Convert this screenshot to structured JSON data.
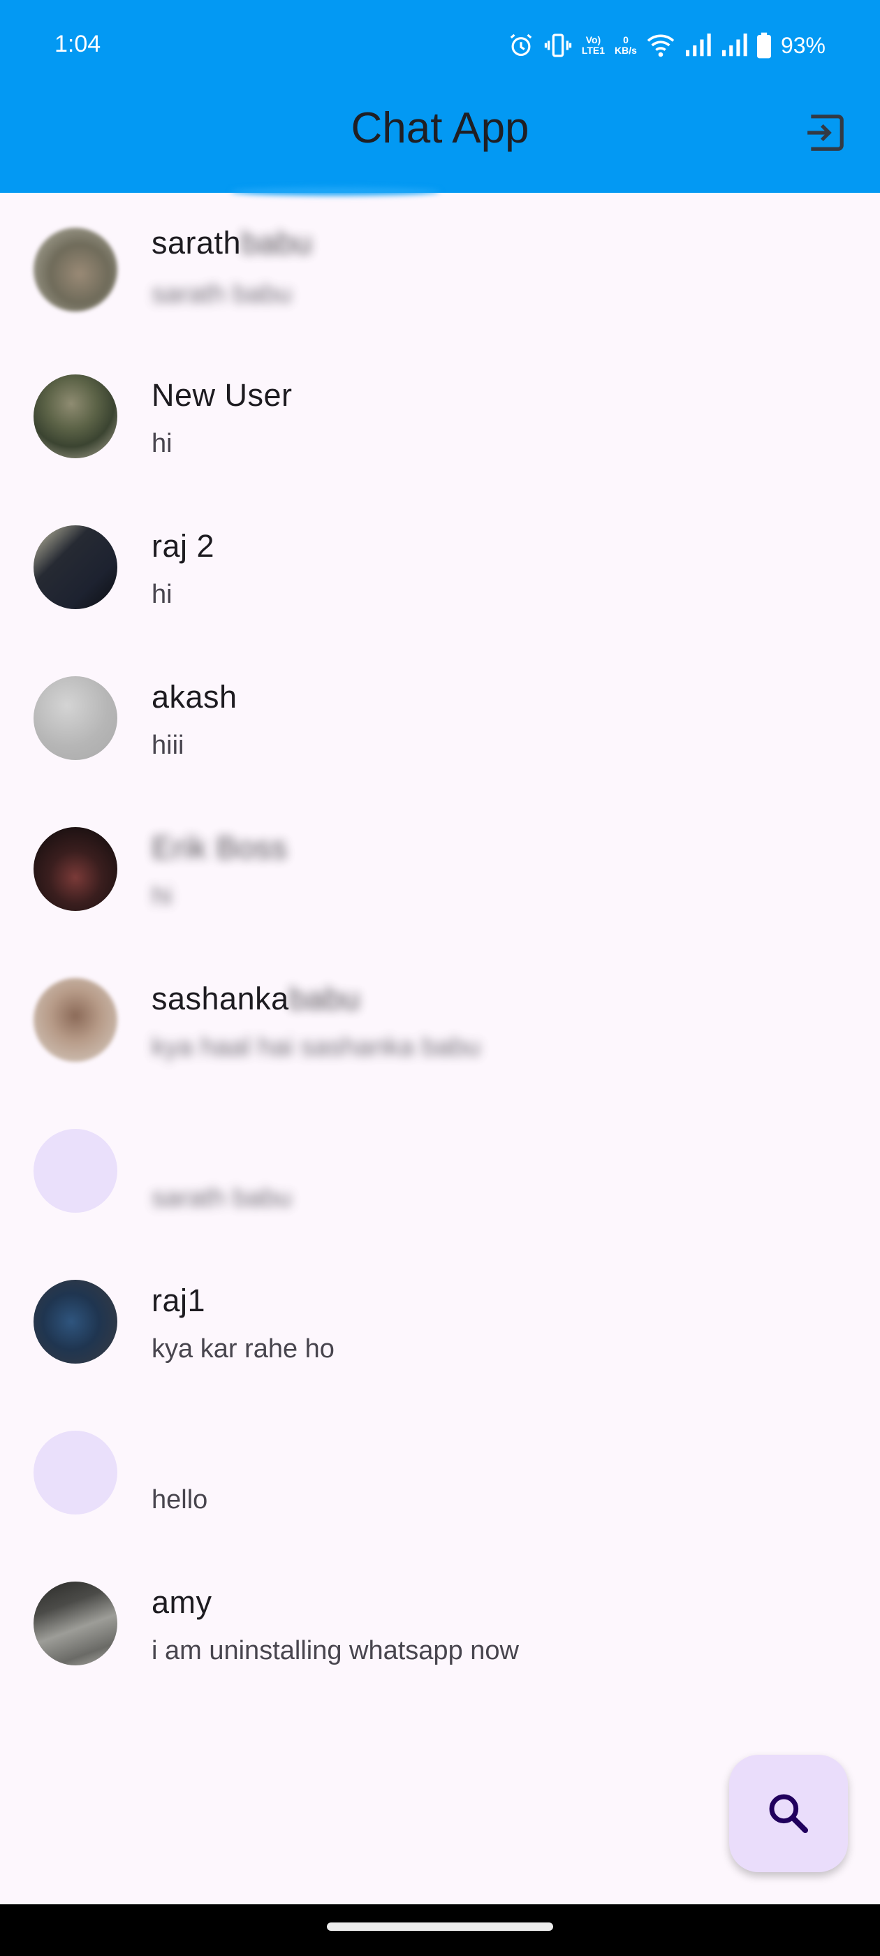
{
  "status_bar": {
    "time": "1:04",
    "net_top": "Vo)",
    "net_bottom": "LTE1",
    "speed_top": "0",
    "speed_bottom": "KB/s",
    "battery": "93%"
  },
  "app_bar": {
    "title": "Chat App",
    "action_icon": "logout-icon"
  },
  "chats": [
    {
      "name": "sarath",
      "name_hidden": "babu",
      "message": "sarath babu",
      "avatar": "photo",
      "blur_message": true
    },
    {
      "name": "New User",
      "name_hidden": "",
      "message": "hi",
      "avatar": "photo",
      "blur_message": false
    },
    {
      "name": "raj 2",
      "name_hidden": "",
      "message": "hi",
      "avatar": "photo",
      "blur_message": false
    },
    {
      "name": "akash",
      "name_hidden": "",
      "message": "hiii",
      "avatar": "photo",
      "blur_message": false
    },
    {
      "name": "",
      "name_hidden": "Erik Boss",
      "message": "hi",
      "avatar": "photo",
      "blur_message": true
    },
    {
      "name": "sashanka",
      "name_hidden": "babu",
      "message": "kya haal hai sashanka babu",
      "avatar": "photo",
      "blur_message": true
    },
    {
      "name": "",
      "name_hidden": "",
      "message": "sarath babu",
      "avatar": "blank",
      "blur_message": true
    },
    {
      "name": "raj1",
      "name_hidden": "",
      "message": "kya kar rahe ho",
      "avatar": "photo",
      "blur_message": false
    },
    {
      "name": "",
      "name_hidden": "",
      "message": "hello",
      "avatar": "blank",
      "blur_message": false
    },
    {
      "name": "amy",
      "name_hidden": "",
      "message": "i am uninstalling whatsapp now",
      "avatar": "photo",
      "blur_message": false
    }
  ],
  "fab": {
    "icon": "search-icon"
  },
  "colors": {
    "app_bar": "#0399f3",
    "background": "#fdf7fd",
    "fab": "#eaddfb",
    "blank_avatar": "#eae0fb"
  }
}
